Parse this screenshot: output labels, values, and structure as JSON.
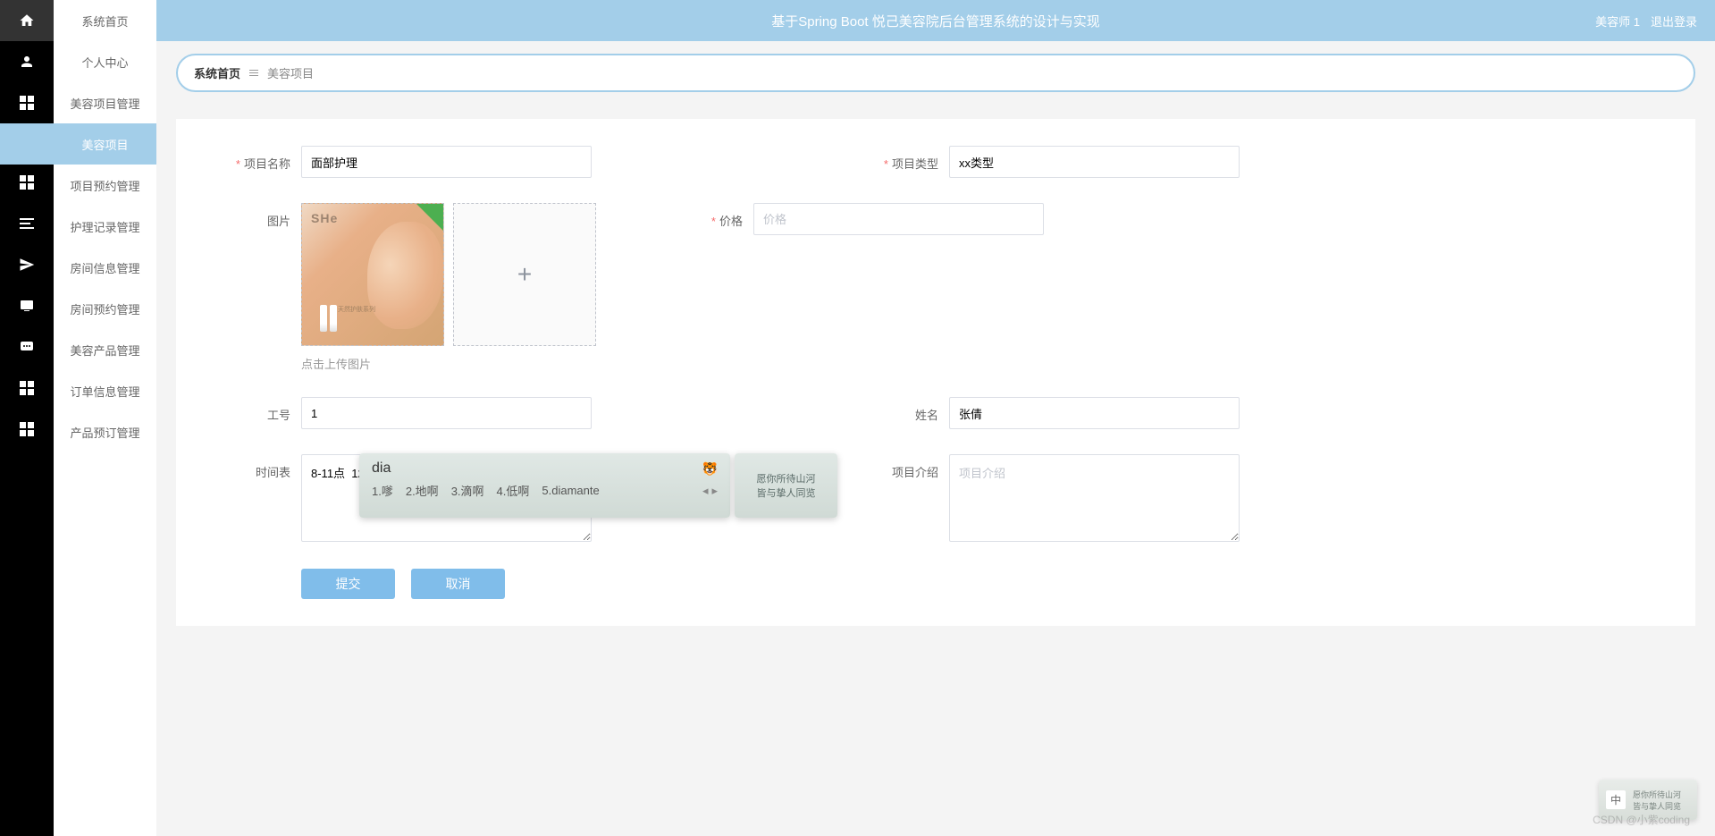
{
  "header": {
    "title": "基于Spring Boot 悦己美容院后台管理系统的设计与实现",
    "user": "美容师 1",
    "logout": "退出登录"
  },
  "sidebar": {
    "items": [
      {
        "label": "系统首页"
      },
      {
        "label": "个人中心"
      },
      {
        "label": "美容项目管理"
      },
      {
        "label": "美容项目"
      },
      {
        "label": "项目预约管理"
      },
      {
        "label": "护理记录管理"
      },
      {
        "label": "房间信息管理"
      },
      {
        "label": "房间预约管理"
      },
      {
        "label": "美容产品管理"
      },
      {
        "label": "订单信息管理"
      },
      {
        "label": "产品预订管理"
      }
    ]
  },
  "breadcrumb": {
    "home": "系统首页",
    "current": "美容项目"
  },
  "form": {
    "project_name": {
      "label": "项目名称",
      "value": "面部护理"
    },
    "project_type": {
      "label": "项目类型",
      "value": "xx类型"
    },
    "image": {
      "label": "图片",
      "hint": "点击上传图片",
      "brand": "SHe",
      "subtitle": "天然护肤系列"
    },
    "price": {
      "label": "价格",
      "placeholder": "价格",
      "value": ""
    },
    "worker_id": {
      "label": "工号",
      "value": "1"
    },
    "name": {
      "label": "姓名",
      "value": "张倩"
    },
    "schedule": {
      "label": "时间表",
      "value": "8-11点  12-18di"
    },
    "intro": {
      "label": "项目介绍",
      "placeholder": "项目介绍",
      "value": ""
    }
  },
  "buttons": {
    "submit": "提交",
    "cancel": "取消"
  },
  "ime": {
    "input": "dia",
    "emoji": "🐯",
    "candidates": [
      "1.嗲",
      "2.地啊",
      "3.滴啊",
      "4.低啊",
      "5.diamante"
    ],
    "side_text1": "愿你所待山河",
    "side_text2": "皆与挚人同览"
  },
  "bottom_widget": {
    "lang": "中",
    "text1": "愿你所待山河",
    "text2": "皆与挚人同览"
  },
  "watermark": "CSDN @小紫coding"
}
